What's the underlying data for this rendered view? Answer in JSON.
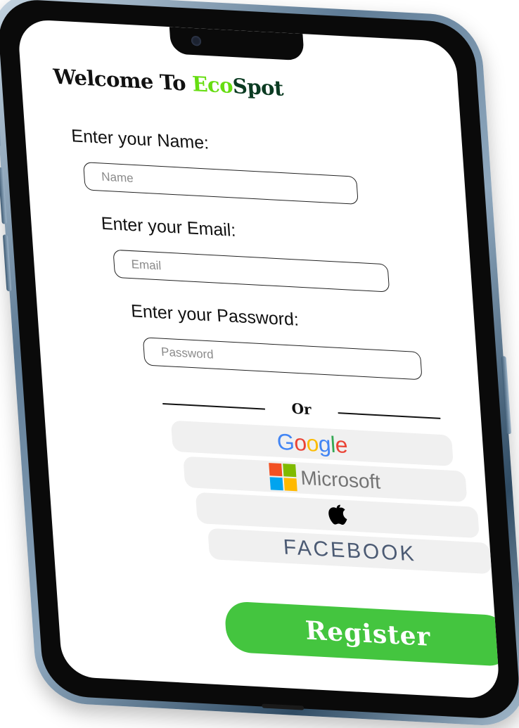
{
  "app": {
    "title_prefix": "Welcome To ",
    "brand_part1": "Eco",
    "brand_part2": "Spot"
  },
  "form": {
    "name_label": "Enter your Name:",
    "name_placeholder": "Name",
    "email_label": "Enter your Email:",
    "email_placeholder": "Email",
    "password_label": "Enter your Password:",
    "password_placeholder": "Password"
  },
  "divider": {
    "text": "Or"
  },
  "social": {
    "google": [
      "G",
      "o",
      "o",
      "g",
      "l",
      "e"
    ],
    "microsoft": "Microsoft",
    "apple_icon": "apple-icon",
    "facebook": "FACEBOOK"
  },
  "register": {
    "label": "Register"
  },
  "colors": {
    "brand_eco": "#66dd11",
    "brand_spot": "#0b3b22",
    "register_bg": "#44c53f",
    "social_bg": "#f0f0f0"
  }
}
